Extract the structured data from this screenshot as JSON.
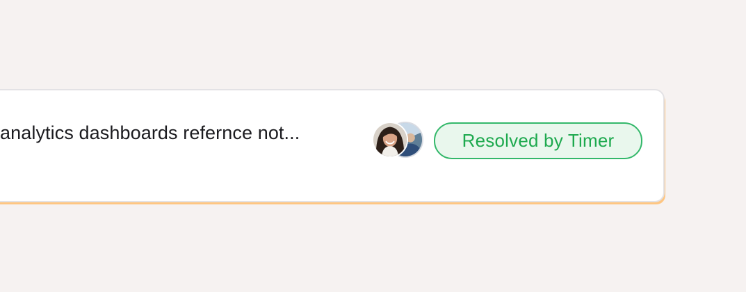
{
  "card": {
    "title": "analytics dashboards refernce not...",
    "status_badge": "Resolved by Timer"
  },
  "icons": {
    "avatar_primary": "woman-portrait-avatar",
    "avatar_secondary": "landscape-portrait-avatar"
  },
  "colors": {
    "background": "#f6f2f1",
    "card_border": "#e3e2e5",
    "card_glow": "#ffbe6e",
    "badge_border": "#33b86a",
    "badge_fill": "#e9f7ed",
    "badge_text": "#1da94e"
  }
}
